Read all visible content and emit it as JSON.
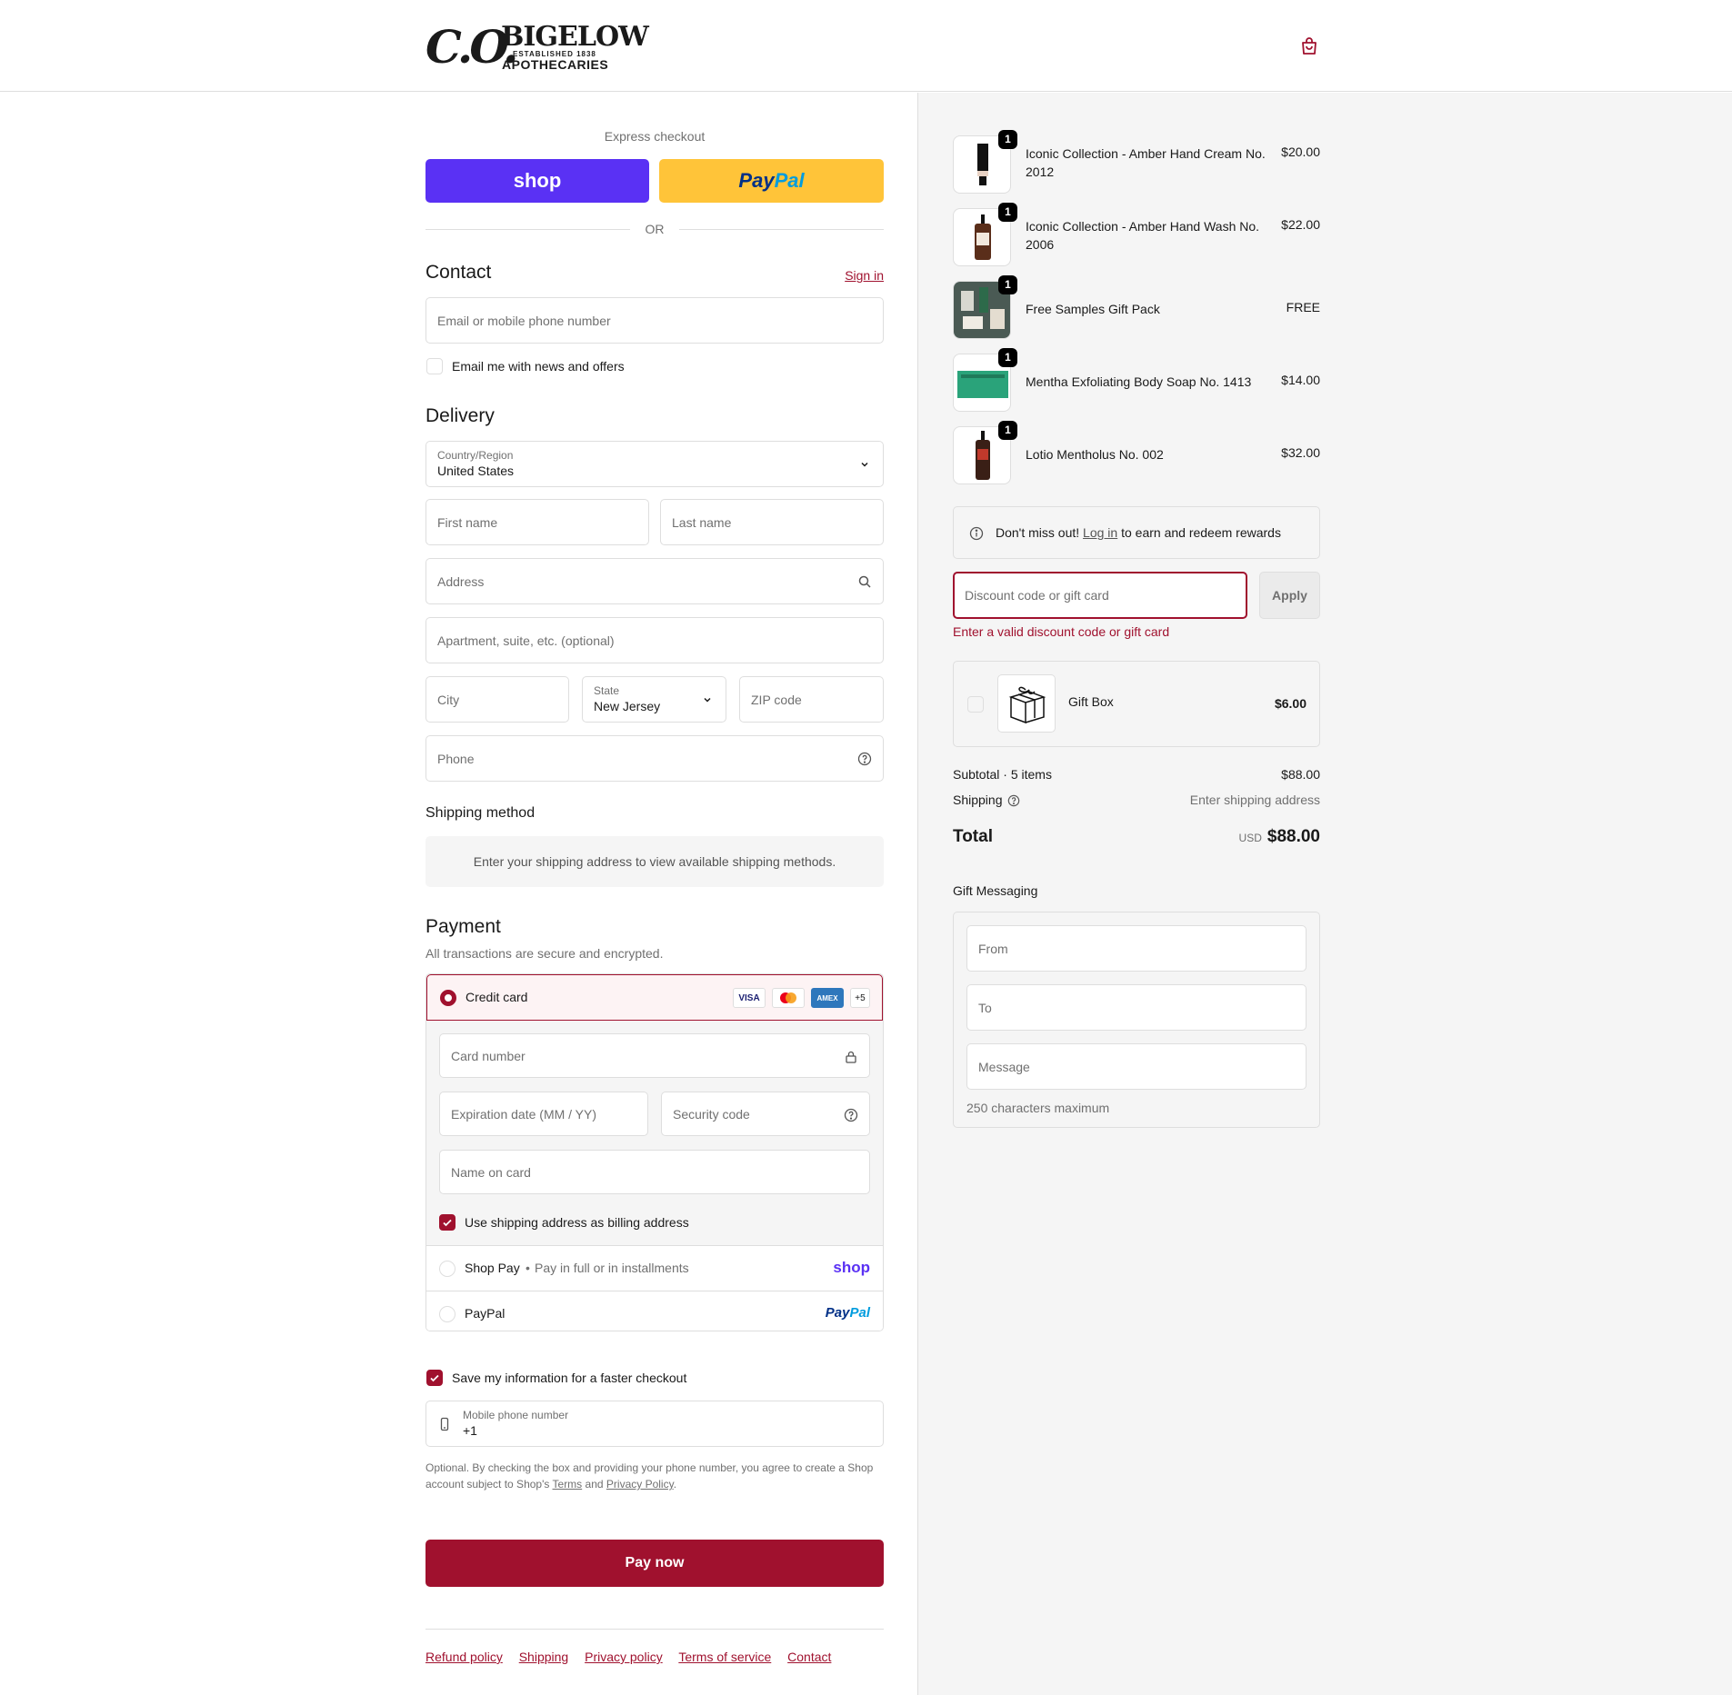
{
  "brand": {
    "logo_mark": "C.O.",
    "logo_name": "BIGELOW",
    "logo_established": "ESTABLISHED 1838",
    "logo_sub": "APOTHECARIES",
    "accent_color": "#a0112e"
  },
  "express": {
    "label": "Express checkout",
    "shop_label": "shop",
    "paypal_a": "Pay",
    "paypal_b": "Pal",
    "or_label": "OR"
  },
  "contact": {
    "title": "Contact",
    "sign_in": "Sign in",
    "email_placeholder": "Email or mobile phone number",
    "news_label": "Email me with news and offers"
  },
  "delivery": {
    "title": "Delivery",
    "country_label": "Country/Region",
    "country_value": "United States",
    "first_name": "First name",
    "last_name": "Last name",
    "address": "Address",
    "apartment": "Apartment, suite, etc. (optional)",
    "city": "City",
    "state_label": "State",
    "state_value": "New Jersey",
    "zip": "ZIP code",
    "phone": "Phone"
  },
  "shipping_method": {
    "title": "Shipping method",
    "message": "Enter your shipping address to view available shipping methods."
  },
  "payment": {
    "title": "Payment",
    "subtitle": "All transactions are secure and encrypted.",
    "credit_card_label": "Credit card",
    "cards": [
      "VISA",
      "MC",
      "AMEX",
      "+5"
    ],
    "card_number": "Card number",
    "expiration": "Expiration date (MM / YY)",
    "security_code": "Security code",
    "name_on_card": "Name on card",
    "billing_same": "Use shipping address as billing address",
    "shop_pay_label": "Shop Pay",
    "shop_pay_sub": "Pay in full or in installments",
    "shop_pay_logo": "shop",
    "paypal_label": "PayPal",
    "paypal_logo_a": "Pay",
    "paypal_logo_b": "Pal"
  },
  "save_info": {
    "label": "Save my information for a faster checkout",
    "mobile_label": "Mobile phone number",
    "mobile_value": "+1",
    "legal_1": "Optional. By checking the box and providing your phone number, you agree to create a Shop",
    "legal_2": "account subject to Shop's",
    "terms": "Terms",
    "and": "and",
    "privacy": "Privacy Policy",
    "period": "."
  },
  "pay_now": "Pay now",
  "footer": [
    "Refund policy",
    "Shipping",
    "Privacy policy",
    "Terms of service",
    "Contact"
  ],
  "cart": {
    "items": [
      {
        "name_1": "Iconic Collection - Amber Hand Cream No.",
        "name_2": "2012",
        "price": "$20.00",
        "qty": "1"
      },
      {
        "name_1": "Iconic Collection - Amber Hand Wash No.",
        "name_2": "2006",
        "price": "$22.00",
        "qty": "1"
      },
      {
        "name_1": "Free Samples Gift Pack",
        "name_2": "",
        "price": "FREE",
        "qty": "1"
      },
      {
        "name_1": "Mentha Exfoliating Body Soap No. 1413",
        "name_2": "",
        "price": "$14.00",
        "qty": "1"
      },
      {
        "name_1": "Lotio Mentholus No. 002",
        "name_2": "",
        "price": "$32.00",
        "qty": "1"
      }
    ],
    "rewards_a": "Don't miss out!",
    "rewards_link": "Log in",
    "rewards_b": "to earn and redeem rewards",
    "discount_placeholder": "Discount code or gift card",
    "apply": "Apply",
    "discount_error": "Enter a valid discount code or gift card",
    "gift_box_name": "Gift Box",
    "gift_box_price": "$6.00",
    "subtotal_label": "Subtotal · 5 items",
    "subtotal_value": "$88.00",
    "shipping_label": "Shipping",
    "shipping_value": "Enter shipping address",
    "total_label": "Total",
    "total_currency": "USD",
    "total_value": "$88.00"
  },
  "gift_messaging": {
    "title": "Gift Messaging",
    "from": "From",
    "to": "To",
    "message": "Message",
    "limit": "250 characters maximum"
  }
}
